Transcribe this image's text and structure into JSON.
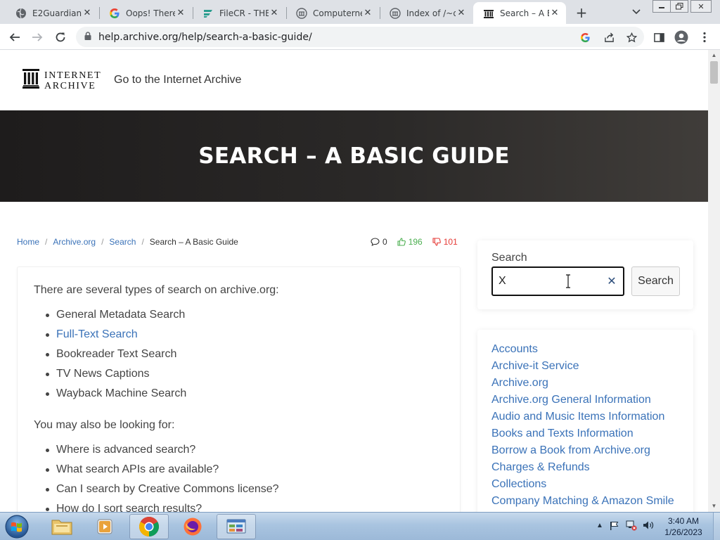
{
  "browser": {
    "tabs": [
      {
        "title": "E2Guardian",
        "icon": "globe-icon",
        "active": false
      },
      {
        "title": "Oops! There",
        "icon": "google-icon",
        "active": false
      },
      {
        "title": "FileCR - THE",
        "icon": "filecr-icon",
        "active": false
      },
      {
        "title": "Computerne",
        "icon": "archive-icon",
        "active": false
      },
      {
        "title": "Index of /~d",
        "icon": "archive-icon",
        "active": false
      },
      {
        "title": "Search – A B",
        "icon": "archive-icon",
        "active": true
      }
    ],
    "url": "help.archive.org/help/search-a-basic-guide/"
  },
  "site": {
    "logo_line1": "INTERNET",
    "logo_line2": "ARCHIVE",
    "goto_link": "Go to the Internet Archive",
    "hero_title": "SEARCH – A BASIC GUIDE"
  },
  "breadcrumb": {
    "items": [
      "Home",
      "Archive.org",
      "Search"
    ],
    "current": "Search – A Basic Guide"
  },
  "meta": {
    "comments": "0",
    "likes": "196",
    "dislikes": "101",
    "like_color": "#4caf50",
    "dislike_color": "#e53935"
  },
  "article": {
    "intro": "There are several types of search on archive.org:",
    "search_types": [
      "General Metadata Search",
      "Full-Text Search",
      "Bookreader Text Search",
      "TV News Captions",
      "Wayback Machine Search"
    ],
    "also_heading": "You may also be looking for:",
    "also_items": [
      "Where is advanced search?",
      "What search APIs are available?",
      "Can I search by Creative Commons license?",
      "How do I sort search results?"
    ]
  },
  "sidebar": {
    "search_label": "Search",
    "search_value": "X",
    "search_button": "Search",
    "categories": [
      "Accounts",
      "Archive-it Service",
      "Archive.org",
      "Archive.org General Information",
      "Audio and Music Items Information",
      "Books and Texts Information",
      "Borrow a Book from Archive.org",
      "Charges & Refunds",
      "Collections",
      "Company Matching & Amazon Smile"
    ]
  },
  "taskbar": {
    "time": "3:40 AM",
    "date": "1/26/2023"
  },
  "colors": {
    "link": "#3a72b8",
    "hero_bg": "#2b2928"
  }
}
